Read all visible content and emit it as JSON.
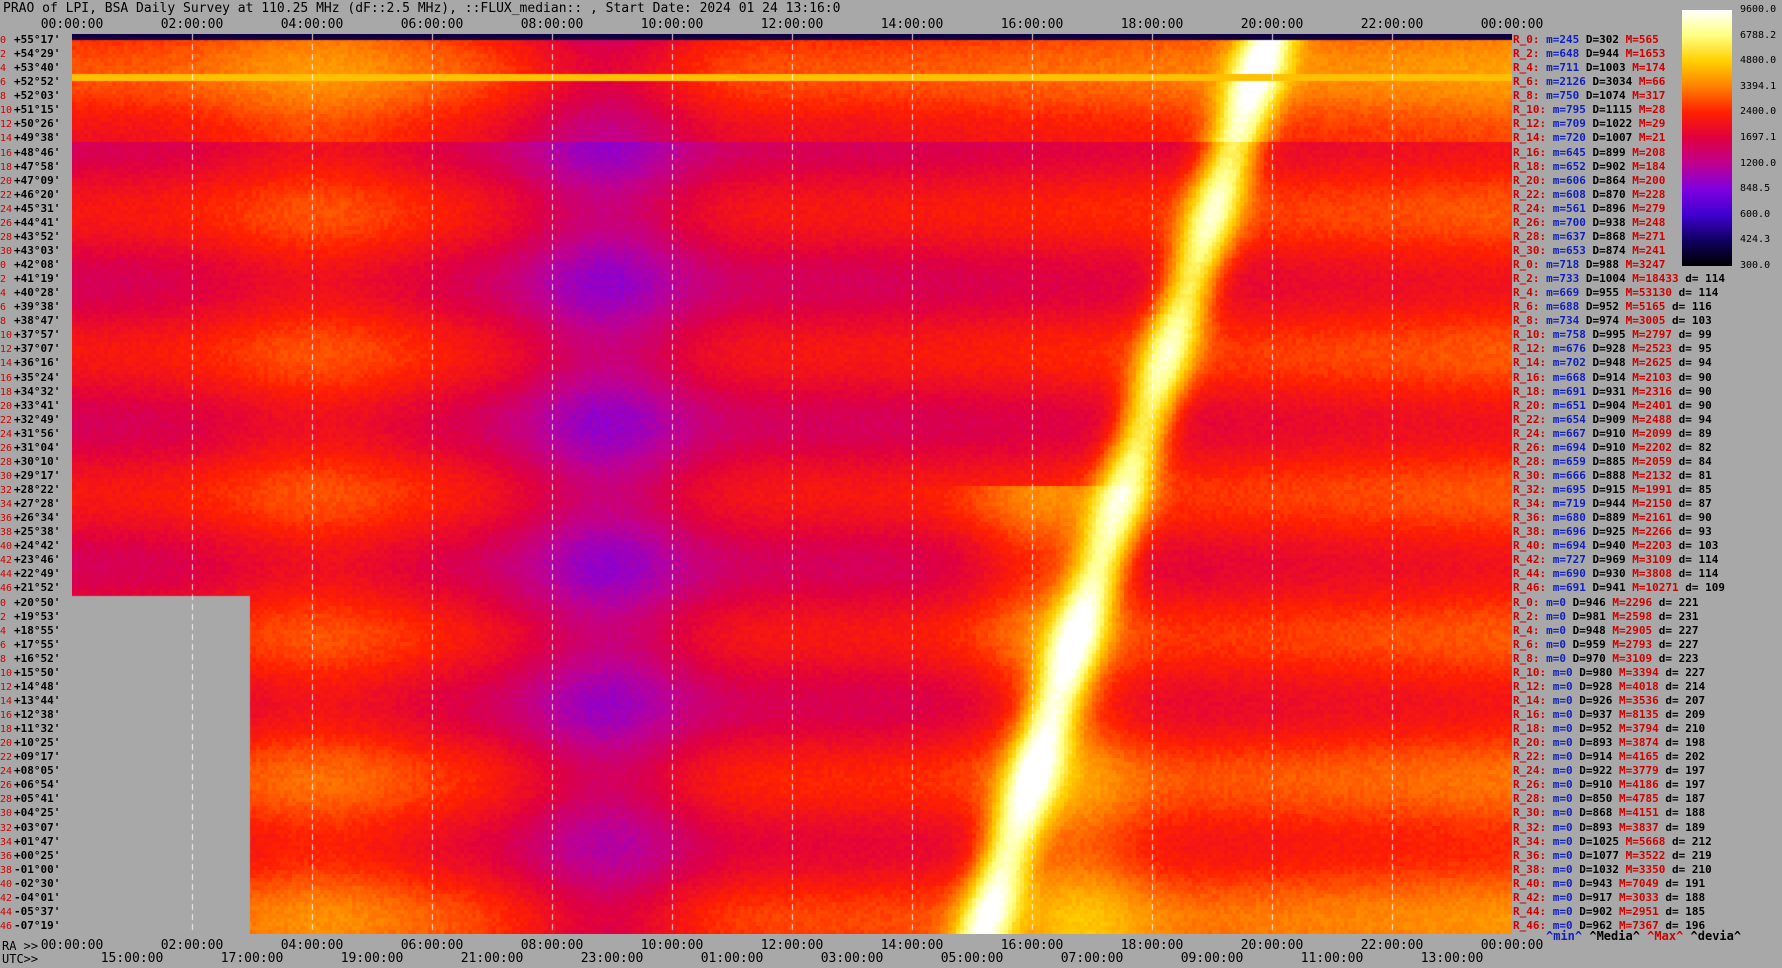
{
  "title": "PRAO of LPI, BSA Daily Survey at 110.25 MHz (dF::2.5 MHz), ::FLUX_median:: , Start Date: 2024 01 24 13:16:0",
  "top_axis_ticks": [
    "00:00:00",
    "02:00:00",
    "04:00:00",
    "06:00:00",
    "08:00:00",
    "10:00:00",
    "12:00:00",
    "14:00:00",
    "16:00:00",
    "18:00:00",
    "20:00:00",
    "22:00:00",
    "00:00:00"
  ],
  "bottom_axis": {
    "ra_label": "RA >>",
    "utc_label": "UTC>>",
    "ra_ticks": [
      "00:00:00",
      "02:00:00",
      "04:00:00",
      "06:00:00",
      "08:00:00",
      "10:00:00",
      "12:00:00",
      "14:00:00",
      "16:00:00",
      "18:00:00",
      "20:00:00",
      "22:00:00",
      "00:00:00"
    ],
    "utc_ticks": [
      "15:00:00",
      "17:00:00",
      "19:00:00",
      "21:00:00",
      "23:00:00",
      "01:00:00",
      "03:00:00",
      "05:00:00",
      "07:00:00",
      "09:00:00",
      "11:00:00",
      "13:00:00"
    ]
  },
  "declinations": [
    {
      "idx": "0",
      "dec": "+55°17'"
    },
    {
      "idx": "2",
      "dec": "+54°29'"
    },
    {
      "idx": "4",
      "dec": "+53°40'"
    },
    {
      "idx": "6",
      "dec": "+52°52'"
    },
    {
      "idx": "8",
      "dec": "+52°03'"
    },
    {
      "idx": "10",
      "dec": "+51°15'"
    },
    {
      "idx": "12",
      "dec": "+50°26'"
    },
    {
      "idx": "14",
      "dec": "+49°38'"
    },
    {
      "idx": "16",
      "dec": "+48°46'"
    },
    {
      "idx": "18",
      "dec": "+47°58'"
    },
    {
      "idx": "20",
      "dec": "+47°09'"
    },
    {
      "idx": "22",
      "dec": "+46°20'"
    },
    {
      "idx": "24",
      "dec": "+45°31'"
    },
    {
      "idx": "26",
      "dec": "+44°41'"
    },
    {
      "idx": "28",
      "dec": "+43°52'"
    },
    {
      "idx": "30",
      "dec": "+43°03'"
    },
    {
      "idx": "0",
      "dec": "+42°08'"
    },
    {
      "idx": "2",
      "dec": "+41°19'"
    },
    {
      "idx": "4",
      "dec": "+40°28'"
    },
    {
      "idx": "6",
      "dec": "+39°38'"
    },
    {
      "idx": "8",
      "dec": "+38°47'"
    },
    {
      "idx": "10",
      "dec": "+37°57'"
    },
    {
      "idx": "12",
      "dec": "+37°07'"
    },
    {
      "idx": "14",
      "dec": "+36°16'"
    },
    {
      "idx": "16",
      "dec": "+35°24'"
    },
    {
      "idx": "18",
      "dec": "+34°32'"
    },
    {
      "idx": "20",
      "dec": "+33°41'"
    },
    {
      "idx": "22",
      "dec": "+32°49'"
    },
    {
      "idx": "24",
      "dec": "+31°56'"
    },
    {
      "idx": "26",
      "dec": "+31°04'"
    },
    {
      "idx": "28",
      "dec": "+30°10'"
    },
    {
      "idx": "30",
      "dec": "+29°17'"
    },
    {
      "idx": "32",
      "dec": "+28°22'"
    },
    {
      "idx": "34",
      "dec": "+27°28'"
    },
    {
      "idx": "36",
      "dec": "+26°34'"
    },
    {
      "idx": "38",
      "dec": "+25°38'"
    },
    {
      "idx": "40",
      "dec": "+24°42'"
    },
    {
      "idx": "42",
      "dec": "+23°46'"
    },
    {
      "idx": "44",
      "dec": "+22°49'"
    },
    {
      "idx": "46",
      "dec": "+21°52'"
    },
    {
      "idx": "0",
      "dec": "+20°50'"
    },
    {
      "idx": "2",
      "dec": "+19°53'"
    },
    {
      "idx": "4",
      "dec": "+18°55'"
    },
    {
      "idx": "6",
      "dec": "+17°55'"
    },
    {
      "idx": "8",
      "dec": "+16°52'"
    },
    {
      "idx": "10",
      "dec": "+15°50'"
    },
    {
      "idx": "12",
      "dec": "+14°48'"
    },
    {
      "idx": "14",
      "dec": "+13°44'"
    },
    {
      "idx": "16",
      "dec": "+12°38'"
    },
    {
      "idx": "18",
      "dec": "+11°32'"
    },
    {
      "idx": "20",
      "dec": "+10°25'"
    },
    {
      "idx": "22",
      "dec": "+09°17'"
    },
    {
      "idx": "24",
      "dec": "+08°05'"
    },
    {
      "idx": "26",
      "dec": "+06°54'"
    },
    {
      "idx": "28",
      "dec": "+05°41'"
    },
    {
      "idx": "30",
      "dec": "+04°25'"
    },
    {
      "idx": "32",
      "dec": "+03°07'"
    },
    {
      "idx": "34",
      "dec": "+01°47'"
    },
    {
      "idx": "36",
      "dec": "+00°25'"
    },
    {
      "idx": "38",
      "dec": "-01°00'"
    },
    {
      "idx": "40",
      "dec": "-02°30'"
    },
    {
      "idx": "42",
      "dec": "-04°01'"
    },
    {
      "idx": "44",
      "dec": "-05°37'"
    },
    {
      "idx": "46",
      "dec": "-07°19'"
    }
  ],
  "stats": [
    {
      "k": "R_0:",
      "m": "245",
      "D": "302",
      "M": "565",
      "d": ""
    },
    {
      "k": "R_2:",
      "m": "648",
      "D": "944",
      "M": "1653",
      "d": ""
    },
    {
      "k": "R_4:",
      "m": "711",
      "D": "1003",
      "M": "174",
      "d": ""
    },
    {
      "k": "R_6:",
      "m": "2126",
      "D": "3034",
      "M": "66",
      "d": ""
    },
    {
      "k": "R_8:",
      "m": "750",
      "D": "1074",
      "M": "317",
      "d": ""
    },
    {
      "k": "R_10:",
      "m": "795",
      "D": "1115",
      "M": "28",
      "d": ""
    },
    {
      "k": "R_12:",
      "m": "709",
      "D": "1022",
      "M": "29",
      "d": ""
    },
    {
      "k": "R_14:",
      "m": "720",
      "D": "1007",
      "M": "21",
      "d": ""
    },
    {
      "k": "R_16:",
      "m": "645",
      "D": "899",
      "M": "208",
      "d": ""
    },
    {
      "k": "R_18:",
      "m": "652",
      "D": "902",
      "M": "184",
      "d": ""
    },
    {
      "k": "R_20:",
      "m": "606",
      "D": "864",
      "M": "200",
      "d": ""
    },
    {
      "k": "R_22:",
      "m": "608",
      "D": "870",
      "M": "228",
      "d": ""
    },
    {
      "k": "R_24:",
      "m": "561",
      "D": "896",
      "M": "279",
      "d": ""
    },
    {
      "k": "R_26:",
      "m": "700",
      "D": "938",
      "M": "248",
      "d": ""
    },
    {
      "k": "R_28:",
      "m": "637",
      "D": "868",
      "M": "271",
      "d": ""
    },
    {
      "k": "R_30:",
      "m": "653",
      "D": "874",
      "M": "241",
      "d": ""
    },
    {
      "k": "R_0:",
      "m": "718",
      "D": "988",
      "M": "3247",
      "d": ""
    },
    {
      "k": "R_2:",
      "m": "733",
      "D": "1004",
      "M": "18433",
      "d": "114"
    },
    {
      "k": "R_4:",
      "m": "669",
      "D": "955",
      "M": "53130",
      "d": "114"
    },
    {
      "k": "R_6:",
      "m": "688",
      "D": "952",
      "M": "5165",
      "d": "116"
    },
    {
      "k": "R_8:",
      "m": "734",
      "D": "974",
      "M": "3005",
      "d": "103"
    },
    {
      "k": "R_10:",
      "m": "758",
      "D": "995",
      "M": "2797",
      "d": "99"
    },
    {
      "k": "R_12:",
      "m": "676",
      "D": "928",
      "M": "2523",
      "d": "95"
    },
    {
      "k": "R_14:",
      "m": "702",
      "D": "948",
      "M": "2625",
      "d": "94"
    },
    {
      "k": "R_16:",
      "m": "668",
      "D": "914",
      "M": "2103",
      "d": "90"
    },
    {
      "k": "R_18:",
      "m": "691",
      "D": "931",
      "M": "2316",
      "d": "90"
    },
    {
      "k": "R_20:",
      "m": "651",
      "D": "904",
      "M": "2401",
      "d": "90"
    },
    {
      "k": "R_22:",
      "m": "654",
      "D": "909",
      "M": "2488",
      "d": "94"
    },
    {
      "k": "R_24:",
      "m": "667",
      "D": "910",
      "M": "2099",
      "d": "89"
    },
    {
      "k": "R_26:",
      "m": "694",
      "D": "910",
      "M": "2202",
      "d": "82"
    },
    {
      "k": "R_28:",
      "m": "659",
      "D": "885",
      "M": "2059",
      "d": "84"
    },
    {
      "k": "R_30:",
      "m": "666",
      "D": "888",
      "M": "2132",
      "d": "81"
    },
    {
      "k": "R_32:",
      "m": "695",
      "D": "915",
      "M": "1991",
      "d": "85"
    },
    {
      "k": "R_34:",
      "m": "719",
      "D": "944",
      "M": "2150",
      "d": "87"
    },
    {
      "k": "R_36:",
      "m": "680",
      "D": "889",
      "M": "2161",
      "d": "90"
    },
    {
      "k": "R_38:",
      "m": "696",
      "D": "925",
      "M": "2266",
      "d": "93"
    },
    {
      "k": "R_40:",
      "m": "694",
      "D": "940",
      "M": "2203",
      "d": "103"
    },
    {
      "k": "R_42:",
      "m": "727",
      "D": "969",
      "M": "3109",
      "d": "114"
    },
    {
      "k": "R_44:",
      "m": "690",
      "D": "930",
      "M": "3808",
      "d": "114"
    },
    {
      "k": "R_46:",
      "m": "691",
      "D": "941",
      "M": "10271",
      "d": "109"
    },
    {
      "k": "R_0:",
      "m": "0",
      "D": "946",
      "M": "2296",
      "d": "221"
    },
    {
      "k": "R_2:",
      "m": "0",
      "D": "981",
      "M": "2598",
      "d": "231"
    },
    {
      "k": "R_4:",
      "m": "0",
      "D": "948",
      "M": "2905",
      "d": "227"
    },
    {
      "k": "R_6:",
      "m": "0",
      "D": "959",
      "M": "2793",
      "d": "227"
    },
    {
      "k": "R_8:",
      "m": "0",
      "D": "970",
      "M": "3109",
      "d": "223"
    },
    {
      "k": "R_10:",
      "m": "0",
      "D": "980",
      "M": "3394",
      "d": "227"
    },
    {
      "k": "R_12:",
      "m": "0",
      "D": "928",
      "M": "4018",
      "d": "214"
    },
    {
      "k": "R_14:",
      "m": "0",
      "D": "926",
      "M": "3536",
      "d": "207"
    },
    {
      "k": "R_16:",
      "m": "0",
      "D": "937",
      "M": "8135",
      "d": "209"
    },
    {
      "k": "R_18:",
      "m": "0",
      "D": "952",
      "M": "3794",
      "d": "210"
    },
    {
      "k": "R_20:",
      "m": "0",
      "D": "893",
      "M": "3874",
      "d": "198"
    },
    {
      "k": "R_22:",
      "m": "0",
      "D": "914",
      "M": "4165",
      "d": "202"
    },
    {
      "k": "R_24:",
      "m": "0",
      "D": "922",
      "M": "3779",
      "d": "197"
    },
    {
      "k": "R_26:",
      "m": "0",
      "D": "910",
      "M": "4186",
      "d": "197"
    },
    {
      "k": "R_28:",
      "m": "0",
      "D": "850",
      "M": "4785",
      "d": "187"
    },
    {
      "k": "R_30:",
      "m": "0",
      "D": "868",
      "M": "4151",
      "d": "188"
    },
    {
      "k": "R_32:",
      "m": "0",
      "D": "893",
      "M": "3837",
      "d": "189"
    },
    {
      "k": "R_34:",
      "m": "0",
      "D": "1025",
      "M": "5668",
      "d": "212"
    },
    {
      "k": "R_36:",
      "m": "0",
      "D": "1077",
      "M": "3522",
      "d": "219"
    },
    {
      "k": "R_38:",
      "m": "0",
      "D": "1032",
      "M": "3350",
      "d": "210"
    },
    {
      "k": "R_40:",
      "m": "0",
      "D": "943",
      "M": "7049",
      "d": "191"
    },
    {
      "k": "R_42:",
      "m": "0",
      "D": "917",
      "M": "3033",
      "d": "188"
    },
    {
      "k": "R_44:",
      "m": "0",
      "D": "902",
      "M": "2951",
      "d": "185"
    },
    {
      "k": "R_46:",
      "m": "0",
      "D": "962",
      "M": "7367",
      "d": "196"
    }
  ],
  "colorbar": {
    "labels": [
      "9600.0",
      "6788.2",
      "4800.0",
      "3394.1",
      "2400.0",
      "1697.1",
      "1200.0",
      "848.5",
      "600.0",
      "424.3",
      "300.0"
    ],
    "colors": [
      "#ffffff",
      "#ffff80",
      "#ffd000",
      "#ff8000",
      "#ff2000",
      "#e00040",
      "#c00090",
      "#8000e0",
      "#4000d0",
      "#100060",
      "#000000"
    ]
  },
  "legend": {
    "min": "^min^",
    "median": "^Media^",
    "max": "^Max^",
    "devia": "^devia^"
  }
}
